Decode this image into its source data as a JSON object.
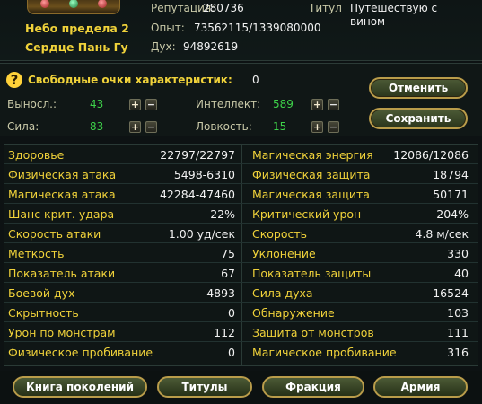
{
  "character": {
    "name_line1": "Небо предела 2",
    "name_line2": "Сердце Пань Гу",
    "reputation_label": "Репутация:",
    "reputation_value": "280736",
    "experience_label": "Опыт:",
    "experience_value": "73562115/1339080000",
    "spirit_label": "Дух:",
    "spirit_value": "94892619",
    "title_label": "Титул",
    "title_value": "Путешествую с вином"
  },
  "attributes": {
    "free_points_label": "Свободные очки характеристик:",
    "free_points_value": "0",
    "endurance_label": "Выносл.:",
    "endurance_value": "43",
    "strength_label": "Сила:",
    "strength_value": "83",
    "intellect_label": "Интеллект:",
    "intellect_value": "589",
    "agility_label": "Ловкость:",
    "agility_value": "15",
    "plus_glyph": "+",
    "minus_glyph": "−",
    "cancel_label": "Отменить",
    "save_label": "Сохранить"
  },
  "stats_left": [
    {
      "label": "Здоровье",
      "value": "22797/22797"
    },
    {
      "label": "Физическая атака",
      "value": "5498-6310"
    },
    {
      "label": "Магическая атака",
      "value": "42284-47460"
    },
    {
      "label": "Шанс крит. удара",
      "value": "22%"
    },
    {
      "label": "Скорость атаки",
      "value": "1.00 уд/сек"
    },
    {
      "label": "Меткость",
      "value": "75"
    },
    {
      "label": "Показатель атаки",
      "value": "67"
    },
    {
      "label": "Боевой дух",
      "value": "4893"
    },
    {
      "label": "Скрытность",
      "value": "0"
    },
    {
      "label": "Урон по монстрам",
      "value": "112"
    },
    {
      "label": "Физическое пробивание",
      "value": "0"
    }
  ],
  "stats_right": [
    {
      "label": "Магическая энергия",
      "value": "12086/12086"
    },
    {
      "label": "Физическая защита",
      "value": "18794"
    },
    {
      "label": "Магическая защита",
      "value": "50171"
    },
    {
      "label": "Критический урон",
      "value": "204%"
    },
    {
      "label": "Скорость",
      "value": "4.8 м/сек"
    },
    {
      "label": "Уклонение",
      "value": "330"
    },
    {
      "label": "Показатель защиты",
      "value": "40"
    },
    {
      "label": "Сила духа",
      "value": "16524"
    },
    {
      "label": "Обнаружение",
      "value": "103"
    },
    {
      "label": "Защита от монстров",
      "value": "111"
    },
    {
      "label": "Магическое пробивание",
      "value": "316"
    }
  ],
  "tabs": {
    "generations": "Книга поколений",
    "titles": "Титулы",
    "faction": "Фракция",
    "army": "Армия"
  },
  "colors": {
    "label_gold": "#f0d23a",
    "attr_green": "#3ed34a",
    "button_border": "#b99c4a"
  }
}
